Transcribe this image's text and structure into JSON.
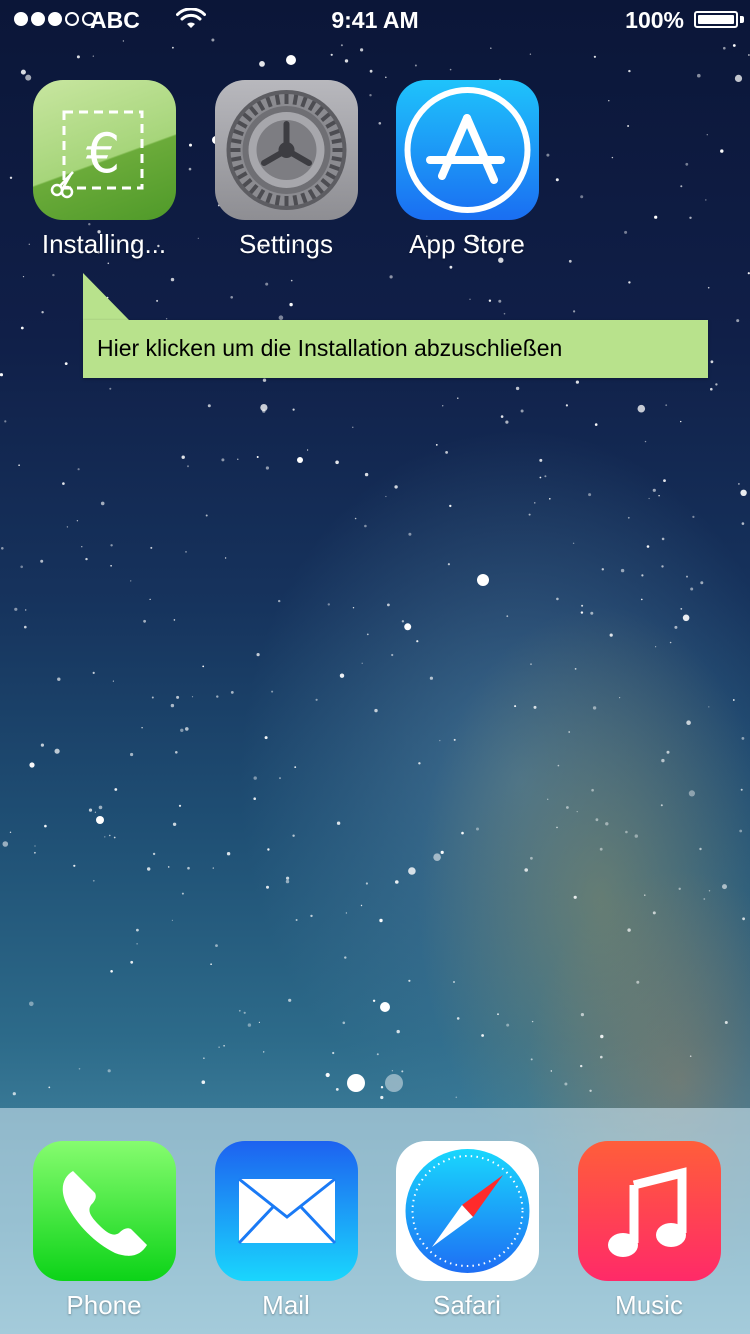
{
  "status_bar": {
    "signal_bars_filled": 3,
    "signal_bars_total": 5,
    "carrier": "ABC",
    "wifi_icon": "wifi-icon",
    "time": "9:41 AM",
    "battery_percent_label": "100%",
    "battery_level": 1.0
  },
  "home_apps": [
    {
      "label": "Installing...",
      "icon": "euro-coupon-icon"
    },
    {
      "label": "Settings",
      "icon": "gear-icon"
    },
    {
      "label": "App Store",
      "icon": "app-store-icon"
    }
  ],
  "tooltip": {
    "text": "Hier klicken um die Installation abzuschließen",
    "background": "#b8e28c"
  },
  "page_indicator": {
    "pages": 2,
    "current": 1
  },
  "dock_apps": [
    {
      "label": "Phone",
      "icon": "phone-icon"
    },
    {
      "label": "Mail",
      "icon": "mail-icon"
    },
    {
      "label": "Safari",
      "icon": "safari-icon"
    },
    {
      "label": "Music",
      "icon": "music-icon"
    }
  ],
  "colors": {
    "installing_green": "#6bab3a",
    "app_store_blue": "#1a6ef2",
    "phone_green": "#0cd318",
    "music_red": "#ff2a68"
  }
}
